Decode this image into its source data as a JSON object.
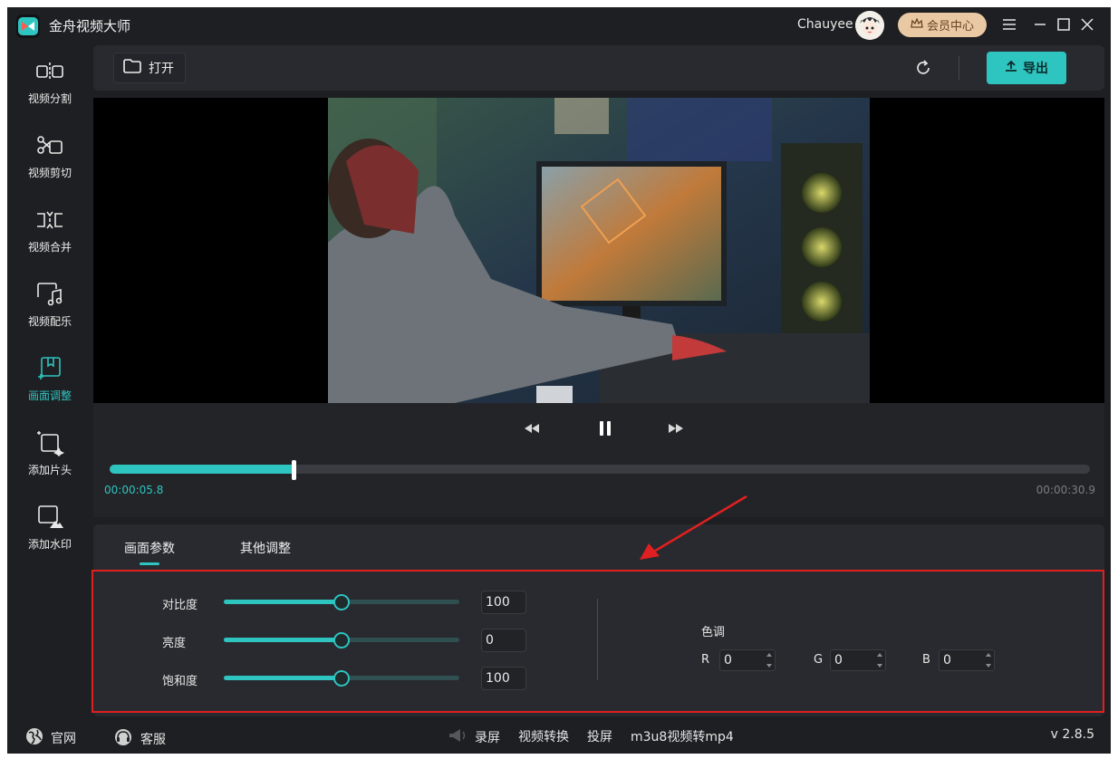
{
  "app": {
    "title": "金舟视频大师",
    "accent": "#2ec4c0"
  },
  "user": {
    "name": "Chauyee",
    "member_label": "会员中心"
  },
  "sidebar": {
    "items": [
      {
        "label": "视频分割",
        "icon": "split-icon",
        "active": false
      },
      {
        "label": "视频剪切",
        "icon": "scissors-icon",
        "active": false
      },
      {
        "label": "视频合并",
        "icon": "merge-icon",
        "active": false
      },
      {
        "label": "视频配乐",
        "icon": "music-icon",
        "active": false
      },
      {
        "label": "画面调整",
        "icon": "adjust-icon",
        "active": true
      },
      {
        "label": "添加片头",
        "icon": "intro-icon",
        "active": false
      },
      {
        "label": "添加水印",
        "icon": "watermark-icon",
        "active": false
      }
    ]
  },
  "toolbar": {
    "open_label": "打开",
    "export_label": "导出"
  },
  "player": {
    "current_time": "00:00:05.8",
    "total_time": "00:00:30.9",
    "progress": 0.188
  },
  "adjust": {
    "tabs": [
      {
        "label": "画面参数",
        "active": true
      },
      {
        "label": "其他调整",
        "active": false
      }
    ],
    "params": [
      {
        "label": "对比度",
        "value": "100",
        "level": 0.5
      },
      {
        "label": "亮度",
        "value": "0",
        "level": 0.5
      },
      {
        "label": "饱和度",
        "value": "100",
        "level": 0.5
      }
    ],
    "hue": {
      "title": "色调",
      "r_label": "R",
      "r_value": "0",
      "g_label": "G",
      "g_value": "0",
      "b_label": "B",
      "b_value": "0"
    }
  },
  "bottombar": {
    "website_label": "官网",
    "service_label": "客服",
    "record_label": "录屏",
    "convert_label": "视频转换",
    "cast_label": "投屏",
    "m3u8_label": "m3u8视频转mp4",
    "version": "v 2.8.5"
  }
}
